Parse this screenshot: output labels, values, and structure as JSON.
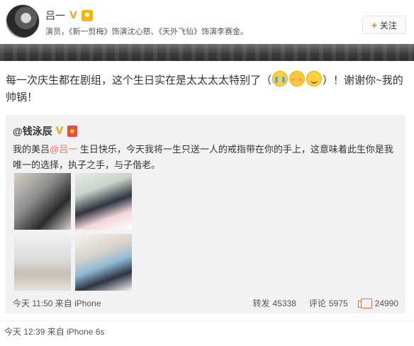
{
  "header": {
    "name": "吕一",
    "verified_badge": "V",
    "description": "演员，《新一剪梅》饰演沈心慈、《天外飞仙》饰演李赛金。",
    "follow_button": "关注",
    "icons": {
      "avatar": "avatar",
      "follow": "plus-icon",
      "badge": "medal-icon"
    },
    "colors": {
      "verified": "#f5a623",
      "follow_plus": "#f36b21"
    }
  },
  "post": {
    "text_before_emoji": "每一次庆生都在剧组，这个生日实在是太太太太特别了（",
    "emojis": [
      "cry-emoji",
      "shy-emoji",
      "smile-emoji"
    ],
    "text_after_emoji": "）！谢谢你~我的帅锅！",
    "time": "今天 12:39 来自 iPhone 6s"
  },
  "repost": {
    "user": "@钱泳辰",
    "verified_badge": "V",
    "text_before_mention": "我的美吕",
    "mention": "@吕一",
    "text_after_mention": " 生日快乐，今天我将一生只送一人的戒指带在你的手上，这意味着此生你是我唯一的选择，执子之手，与子偕老。",
    "photos": [
      "photo-1",
      "photo-2",
      "photo-3",
      "photo-4"
    ],
    "time": "今天 11:50 来自 iPhone",
    "stats": {
      "repost_label": "转发",
      "repost_count": "45338",
      "comment_label": "评论",
      "comment_count": "5975",
      "like_count": "24990"
    },
    "colors": {
      "mention": "#eb7350",
      "background": "#f2f2f5"
    }
  }
}
